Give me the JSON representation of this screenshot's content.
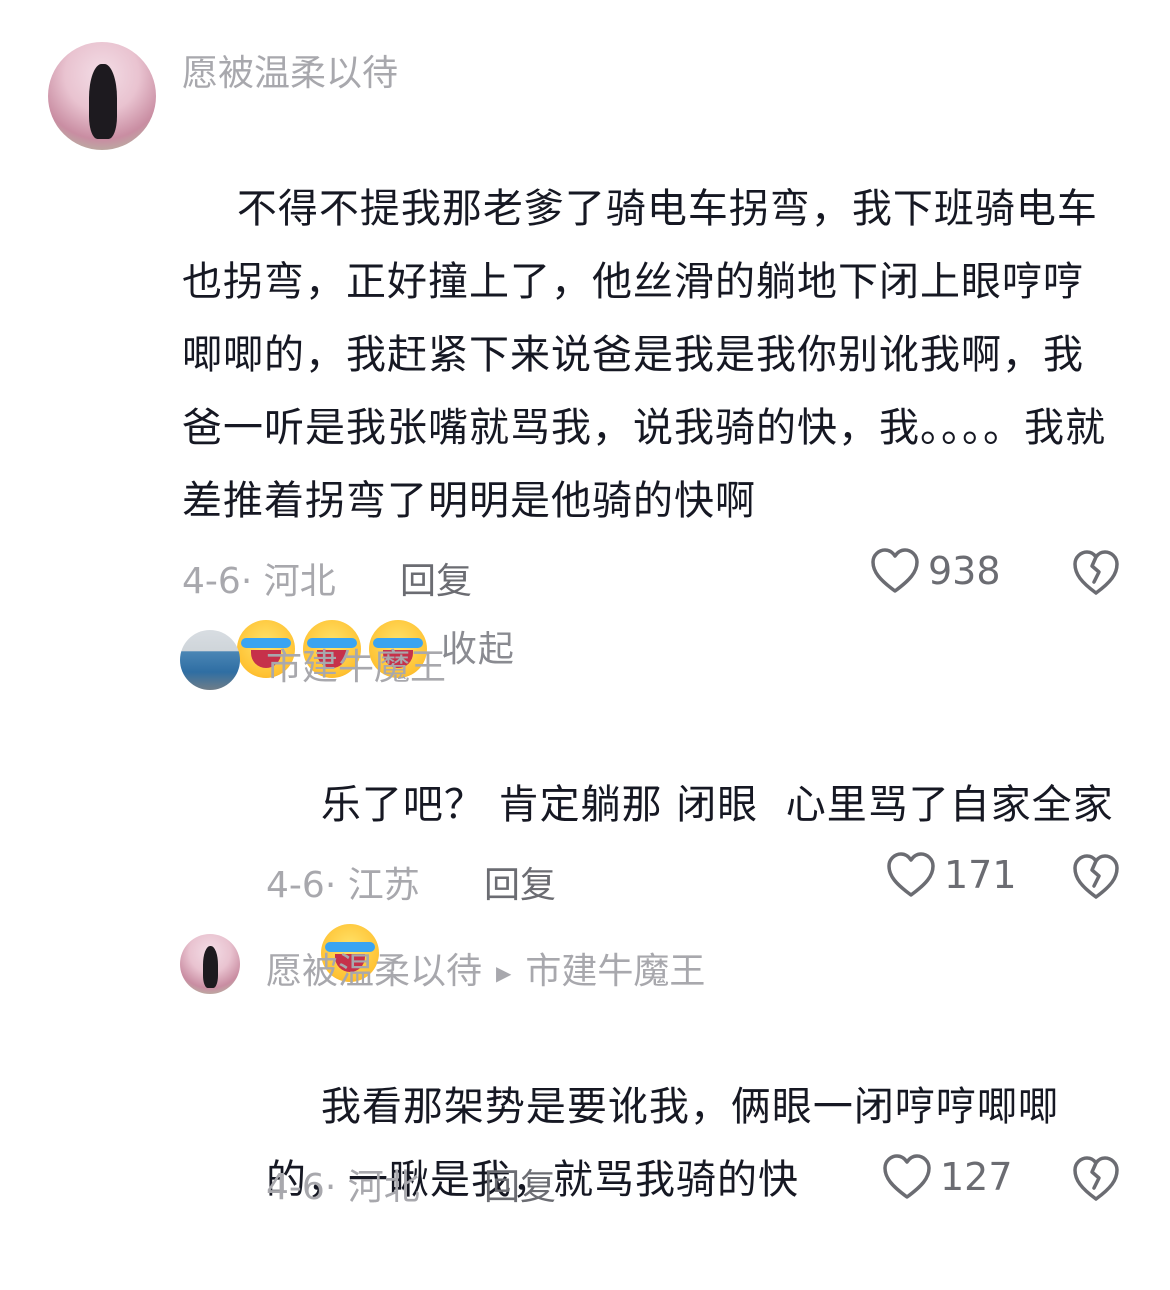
{
  "comments": [
    {
      "username": "愿被温柔以待",
      "text": "不得不提我那老爹了骑电车拐弯，我下班骑电车也拐弯，正好撞上了，他丝滑的躺地下闭上眼哼哼唧唧的，我赶紧下来说爸是我是我你别讹我啊，我爸一听是我张嘴就骂我，说我骑的快，我。。。。我就差推着拐弯了明明是他骑的快啊",
      "collapse_label": "收起",
      "date": "4-6",
      "location": "河北",
      "reply_label": "回复",
      "likes": "938"
    },
    {
      "username": "市建牛魔王",
      "text": "乐了吧？ 肯定躺那 闭眼  心里骂了自家全家",
      "date": "4-6",
      "location": "江苏",
      "reply_label": "回复",
      "likes": "171"
    },
    {
      "username": "愿被温柔以待",
      "reply_to": "市建牛魔王",
      "text": "我看那架势是要讹我，俩眼一闭哼哼唧唧的，一瞅是我，就骂我骑的快",
      "date": "4-6",
      "location": "河北",
      "reply_label": "回复",
      "likes": "127"
    }
  ],
  "meta_separator": "·",
  "icons": {
    "emoji": "crying-laughing-emoji",
    "like": "heart-icon",
    "dislike": "broken-heart-icon"
  }
}
